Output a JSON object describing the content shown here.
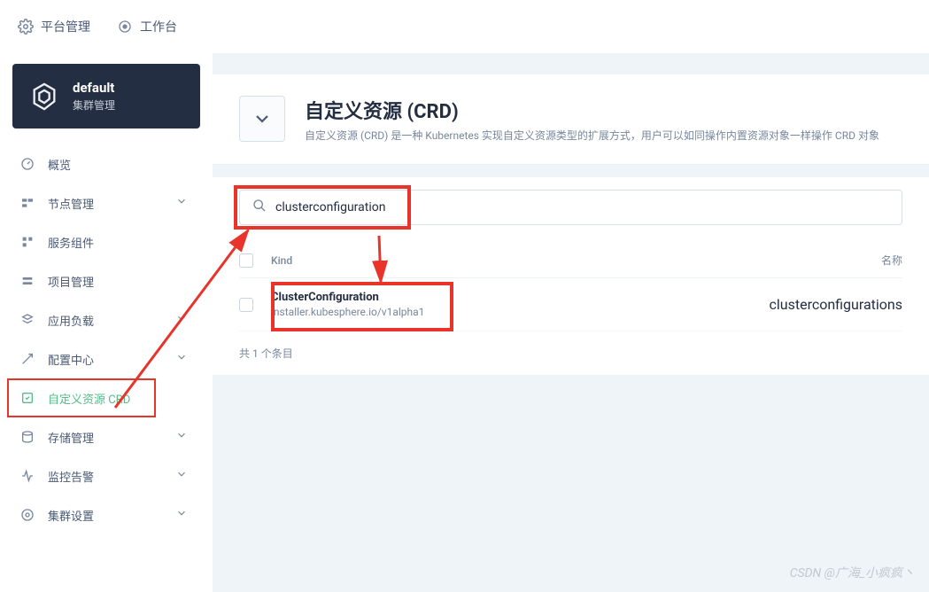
{
  "topBar": {
    "platform": "平台管理",
    "workbench": "工作台"
  },
  "cluster": {
    "name": "default",
    "role": "集群管理"
  },
  "nav": [
    {
      "label": "概览",
      "expandable": false
    },
    {
      "label": "节点管理",
      "expandable": true
    },
    {
      "label": "服务组件",
      "expandable": false
    },
    {
      "label": "项目管理",
      "expandable": false
    },
    {
      "label": "应用负载",
      "expandable": true
    },
    {
      "label": "配置中心",
      "expandable": true
    },
    {
      "label": "自定义资源 CRD",
      "expandable": false,
      "active": true
    },
    {
      "label": "存储管理",
      "expandable": true
    },
    {
      "label": "监控告警",
      "expandable": true
    },
    {
      "label": "集群设置",
      "expandable": true
    }
  ],
  "page": {
    "title": "自定义资源 (CRD)",
    "desc": "自定义资源 (CRD) 是一种 Kubernetes 实现自定义资源类型的扩展方式，用户可以如同操作内置资源对象一样操作 CRD 对象"
  },
  "search": {
    "value": "clusterconfiguration"
  },
  "table": {
    "headers": {
      "kind": "Kind",
      "name": "名称"
    },
    "rows": [
      {
        "kind": "ClusterConfiguration",
        "api": "installer.kubesphere.io/v1alpha1",
        "name": "clusterconfigurations"
      }
    ],
    "summary": "共 1 个条目"
  },
  "watermark": "CSDN @广海_小疯疯丶"
}
